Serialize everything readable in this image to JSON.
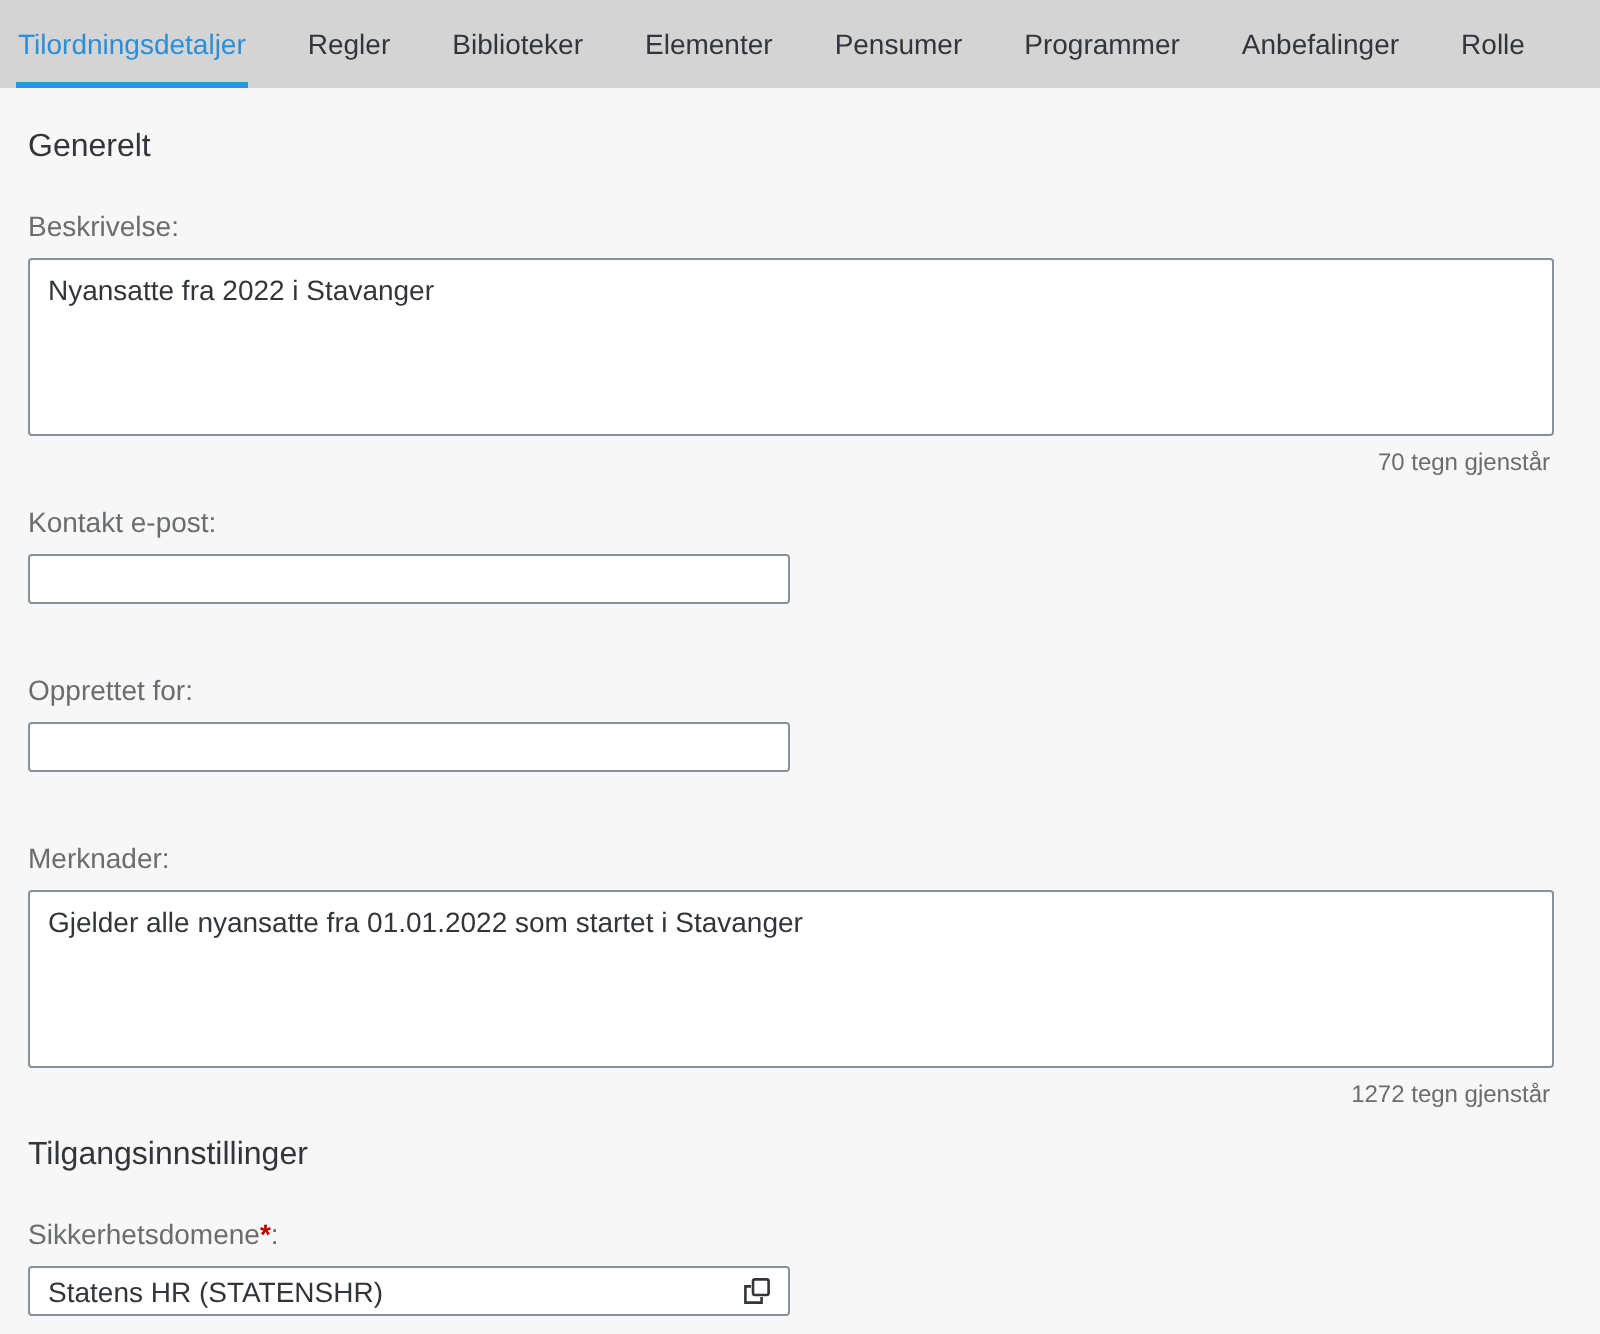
{
  "tabs": [
    {
      "label": "Tilordningsdetaljer",
      "selected": true
    },
    {
      "label": "Regler",
      "selected": false
    },
    {
      "label": "Biblioteker",
      "selected": false
    },
    {
      "label": "Elementer",
      "selected": false
    },
    {
      "label": "Pensumer",
      "selected": false
    },
    {
      "label": "Programmer",
      "selected": false
    },
    {
      "label": "Anbefalinger",
      "selected": false
    },
    {
      "label": "Rolle",
      "selected": false
    }
  ],
  "sections": [
    {
      "title": "Generelt",
      "fields": [
        {
          "kind": "textarea",
          "label": "Beskrivelse:",
          "value": "Nyansatte fra 2022 i Stavanger",
          "counter": "70 tegn gjenstår"
        },
        {
          "kind": "input",
          "label": "Kontakt e-post:"
        },
        {
          "kind": "input",
          "label": "Opprettet for:"
        },
        {
          "kind": "textarea",
          "label": "Merknader:",
          "value": "Gjelder alle nyansatte fra 01.01.2022 som startet i Stavanger",
          "counter": "1272 tegn gjenstår"
        }
      ]
    },
    {
      "title": "Tilgangsinnstillinger",
      "fields": [
        {
          "kind": "valuehelp",
          "label": "Sikkerhetsdomene",
          "required_mark": "*",
          "label_suffix": ":",
          "value": "Statens HR (STATENSHR)"
        }
      ]
    }
  ]
}
